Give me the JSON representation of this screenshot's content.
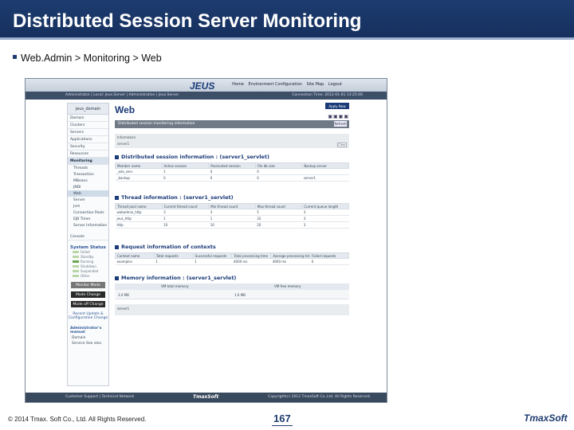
{
  "slide": {
    "title": "Distributed Session Server Monitoring",
    "bullet": "Web.Admin > Monitoring > Web",
    "copyright": "© 2014 Tmax. Soft Co., Ltd. All Rights Reserved.",
    "page_number": "167",
    "brand": "TmaxSoft"
  },
  "colors": {
    "title_bg": "#1e3c70",
    "accent": "#1b3b78"
  },
  "app": {
    "logo": "JEUS",
    "top_nav": [
      "Home",
      "Environment Configuration",
      "Site Map",
      "Logout"
    ],
    "sub_left": "Administrator | Local: Jeus.Server | Administration | Jeus.Server",
    "sub_right": "Connection Time: 2012-01-01 13:25:00",
    "left_nav": {
      "domain": "jeus_domain",
      "items": [
        "Domain",
        "Clusters",
        "Servers",
        "Applications",
        "Security",
        "Resources"
      ],
      "monitoring": "Monitoring",
      "sub_items": [
        "Threads",
        "Transaction",
        "MBeans",
        "JNDI",
        "Web",
        "Server",
        "Jvm",
        "Connection Pools",
        "EJB Timer",
        "Server Information"
      ],
      "console": "Console",
      "status_title": "System Status",
      "status_lines": [
        "Failed",
        "Standby",
        "Running",
        "Shutdown",
        "Suspended",
        "Other"
      ],
      "buttons": [
        "Monitor Mode",
        "Mode Change",
        "Mode off Change"
      ],
      "links": "Recent Update & Configuration Change",
      "manual_title": "Administrator's manual",
      "manual_lines": [
        "Domain",
        "Service  See also"
      ]
    },
    "main": {
      "title": "Web",
      "apply": "Apply Now",
      "toolbar_icons": "▣▣▣▣",
      "info_bar": "Distributed session monitoring information",
      "refresh": "Refresh",
      "filter_label": "Information",
      "filter_value": "server1",
      "clear": "Clear",
      "sessions": {
        "title": "Distributed session information : (server1_servlet)",
        "headers": [
          "Member name",
          "Active session",
          "Passivated session",
          "File db size",
          "Backup server"
        ],
        "rows": [
          [
            "_adv_serv",
            "1",
            "0",
            "0",
            ""
          ],
          [
            "_backup",
            "0",
            "0",
            "0",
            "server1"
          ]
        ]
      },
      "threads": {
        "title": "Thread information : (server1_servlet)",
        "headers": [
          "Thread pool name",
          "Current thread count",
          "Min thread count",
          "Max thread count",
          "Current queue length"
        ],
        "rows": [
          [
            "webadmin_http",
            "3",
            "3",
            "5",
            "3"
          ],
          [
            "jeus_http",
            "1",
            "1",
            "32",
            "3"
          ],
          [
            "http",
            "10",
            "10",
            "20",
            "3"
          ]
        ]
      },
      "contexts": {
        "title": "Request information of contexts",
        "headers": [
          "Context name",
          "Total requests",
          "Successful requests",
          "Total processing time",
          "Average processing time",
          "Failed requests"
        ],
        "rows": [
          [
            "examples",
            "1",
            "1",
            "4000 ms",
            "4000 ms",
            "0"
          ]
        ]
      },
      "memory": {
        "title": "Memory information : (server1_servlet)",
        "headers": [
          "VM total memory",
          "VM free memory"
        ],
        "values": [
          "3.0 MB",
          "1.6 MB"
        ],
        "server": "server1"
      }
    },
    "footer": {
      "left": "Customer Support | Technical Network",
      "center": "TmaxSoft",
      "right": "Copyright(c) 2012 TmaxSoft Co.,Ltd. All Rights Reserved."
    }
  }
}
